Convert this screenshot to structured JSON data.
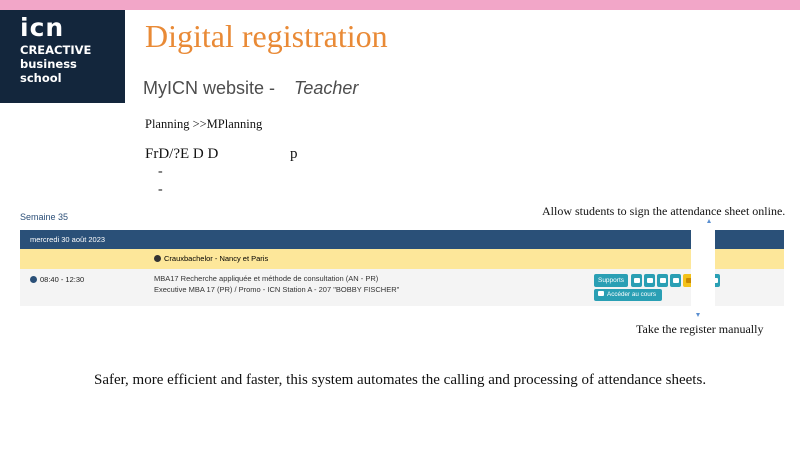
{
  "logo": {
    "line1": "icn",
    "line2": "CREACTIVE",
    "line3": "business",
    "line4": "school"
  },
  "slide": {
    "title": "Digital registration",
    "subtitle_left": "MyICN website -",
    "subtitle_right": "Teacher",
    "planning_line": "Planning   >>MPlanning",
    "garbled_line": "FrD/?E D D",
    "garbled_p": "p",
    "dash1": "-",
    "dash2": "-",
    "bottom_text": "Safer, more efficient and faster, this system automates the calling and processing of attendance sheets."
  },
  "screenshot": {
    "week_label": "Semaine 35",
    "date_label": "mercredi 30 août 2023",
    "location": "Crauxbachelor - Nancy et Paris",
    "time": "08:40 - 12:30",
    "course_title": "MBA17 Recherche appliquée et méthode de consultation (AN - PR)",
    "course_meta": "Executive MBA 17 (PR) / Promo - ICN Station A - 207 \"BOBBY FISCHER\"",
    "buttons": {
      "supports": "Supports",
      "access": "Accéder au cours"
    }
  },
  "annotations": {
    "top": "Allow students to sign the attendance sheet online.",
    "bottom": "Take the register manually"
  },
  "colors": {
    "title": "#e98a36",
    "header": "#2a5078",
    "highlight": "#fde79a",
    "button": "#2a9fb4",
    "button_yellow": "#f3c21b",
    "pink": "#f2a6c8",
    "logo_bg": "#13263c"
  }
}
